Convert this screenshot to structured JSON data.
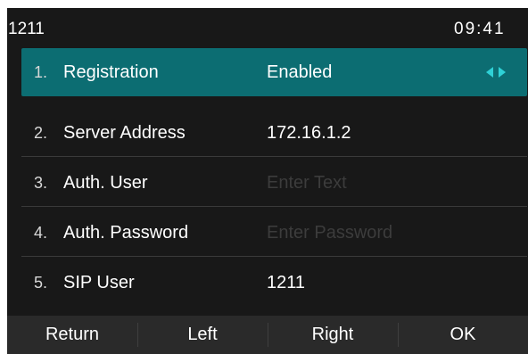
{
  "status_bar": {
    "account": "1211",
    "time": "09:41"
  },
  "rows": [
    {
      "num": "1.",
      "label": "Registration",
      "value": "Enabled"
    },
    {
      "num": "2.",
      "label": "Server Address",
      "value": "172.16.1.2"
    },
    {
      "num": "3.",
      "label": "Auth. User",
      "placeholder": "Enter Text"
    },
    {
      "num": "4.",
      "label": "Auth. Password",
      "placeholder": "Enter Password"
    },
    {
      "num": "5.",
      "label": "SIP User",
      "value": "1211"
    }
  ],
  "softkeys": [
    "Return",
    "Left",
    "Right",
    "OK"
  ],
  "colors": {
    "accent": "#0c6d72",
    "arrow": "#2fd1d6",
    "background": "#181818"
  }
}
